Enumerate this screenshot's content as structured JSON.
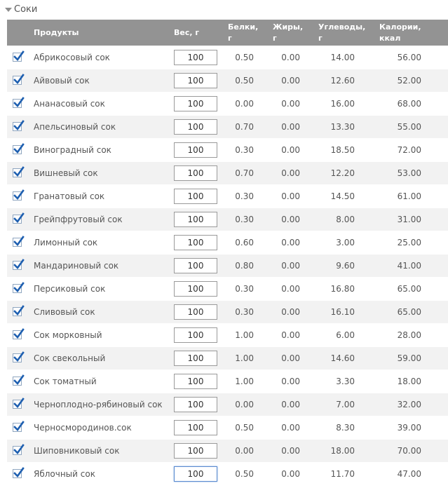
{
  "section": {
    "title": "Соки"
  },
  "header": {
    "product": "Продукты",
    "weight": "Вес, г",
    "protein_line1": "Белки,",
    "protein_line2": "г",
    "fat_line1": "Жиры,",
    "fat_line2": "г",
    "carbs_line1": "Углеводы,",
    "carbs_line2": "г",
    "cal_line1": "Калории,",
    "cal_line2": "ккал"
  },
  "rows": [
    {
      "name": "Абрикосовый сок",
      "weight": "100",
      "protein": "0.50",
      "fat": "0.00",
      "carbs": "14.00",
      "cal": "56.00"
    },
    {
      "name": "Айвовый сок",
      "weight": "100",
      "protein": "0.50",
      "fat": "0.00",
      "carbs": "12.60",
      "cal": "52.00"
    },
    {
      "name": "Ананасовый сок",
      "weight": "100",
      "protein": "0.00",
      "fat": "0.00",
      "carbs": "16.00",
      "cal": "68.00"
    },
    {
      "name": "Апельсиновый сок",
      "weight": "100",
      "protein": "0.70",
      "fat": "0.00",
      "carbs": "13.30",
      "cal": "55.00"
    },
    {
      "name": "Виноградный сок",
      "weight": "100",
      "protein": "0.30",
      "fat": "0.00",
      "carbs": "18.50",
      "cal": "72.00"
    },
    {
      "name": "Вишневый сок",
      "weight": "100",
      "protein": "0.70",
      "fat": "0.00",
      "carbs": "12.20",
      "cal": "53.00"
    },
    {
      "name": "Гранатовый сок",
      "weight": "100",
      "protein": "0.30",
      "fat": "0.00",
      "carbs": "14.50",
      "cal": "61.00"
    },
    {
      "name": "Грейпфрутовый сок",
      "weight": "100",
      "protein": "0.30",
      "fat": "0.00",
      "carbs": "8.00",
      "cal": "31.00"
    },
    {
      "name": "Лимонный сок",
      "weight": "100",
      "protein": "0.60",
      "fat": "0.00",
      "carbs": "3.00",
      "cal": "25.00"
    },
    {
      "name": "Мандариновый сок",
      "weight": "100",
      "protein": "0.80",
      "fat": "0.00",
      "carbs": "9.60",
      "cal": "41.00"
    },
    {
      "name": "Персиковый сок",
      "weight": "100",
      "protein": "0.30",
      "fat": "0.00",
      "carbs": "16.80",
      "cal": "65.00"
    },
    {
      "name": "Сливовый сок",
      "weight": "100",
      "protein": "0.30",
      "fat": "0.00",
      "carbs": "16.10",
      "cal": "65.00"
    },
    {
      "name": "Сок морковный",
      "weight": "100",
      "protein": "1.00",
      "fat": "0.00",
      "carbs": "6.00",
      "cal": "28.00"
    },
    {
      "name": "Сок свекольный",
      "weight": "100",
      "protein": "1.00",
      "fat": "0.00",
      "carbs": "14.60",
      "cal": "59.00"
    },
    {
      "name": "Сок томатный",
      "weight": "100",
      "protein": "1.00",
      "fat": "0.00",
      "carbs": "3.30",
      "cal": "18.00"
    },
    {
      "name": "Черноплодно-рябиновый сок",
      "weight": "100",
      "protein": "0.00",
      "fat": "0.00",
      "carbs": "7.00",
      "cal": "32.00"
    },
    {
      "name": "Черносмородинов.сок",
      "weight": "100",
      "protein": "0.50",
      "fat": "0.00",
      "carbs": "8.30",
      "cal": "39.00"
    },
    {
      "name": "Шиповниковый сок",
      "weight": "100",
      "protein": "0.00",
      "fat": "0.00",
      "carbs": "18.00",
      "cal": "70.00"
    },
    {
      "name": "Яблочный сок",
      "weight": "100",
      "protein": "0.50",
      "fat": "0.00",
      "carbs": "11.70",
      "cal": "47.00"
    }
  ],
  "colors": {
    "header_bg": "#939393",
    "row_alt_bg": "#f2f2f2",
    "checkmark": "#1e5fb0"
  }
}
